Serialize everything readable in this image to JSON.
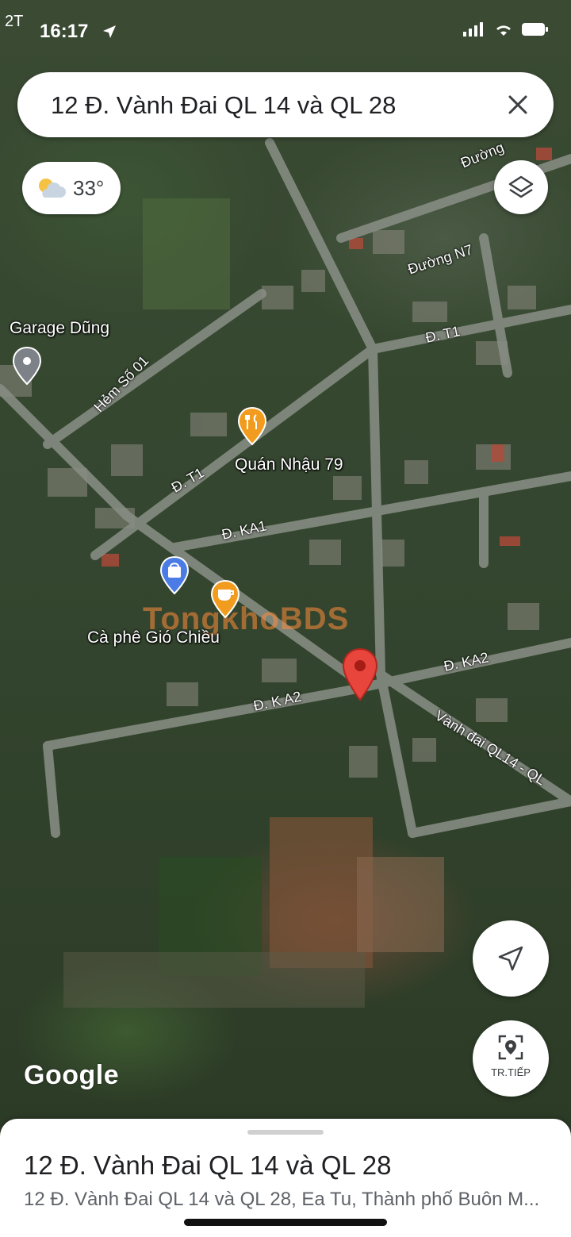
{
  "status_bar": {
    "carrier": "2T",
    "time": "16:17"
  },
  "search": {
    "query": "12 Đ. Vành Đai QL 14 và QL 28",
    "close_icon": "close-icon"
  },
  "weather": {
    "temperature": "33°",
    "icon": "partly-cloudy-icon"
  },
  "places": {
    "garage": "Garage Dũng",
    "restaurant": "Quán Nhậu 79",
    "cafe": "Cà phê Gió Chiều"
  },
  "roads": {
    "duong_top": "Đường",
    "duong_n7": "Đường N7",
    "t1_right": "Đ. T1",
    "hem_so_01": "Hẻm Số 01",
    "t1_left": "Đ. T1",
    "ka1": "Đ. KA1",
    "ka2_right": "Đ. KA2",
    "ka2_left": "Đ. K A2",
    "vanh_dai": "Vành đai QL14 - QL"
  },
  "map": {
    "google_logo": "Google",
    "watermark": "TongkhoBDS",
    "marker_color": "#e8453c"
  },
  "buttons": {
    "layers_icon": "layers-icon",
    "locate_icon": "navigation-arrow-icon",
    "live_view_label": "TR.TIẾP"
  },
  "sheet": {
    "title": "12 Đ. Vành Đai QL 14 và QL 28",
    "address": "12 Đ. Vành Đai QL 14 và QL 28, Ea Tu, Thành phố Buôn M..."
  }
}
